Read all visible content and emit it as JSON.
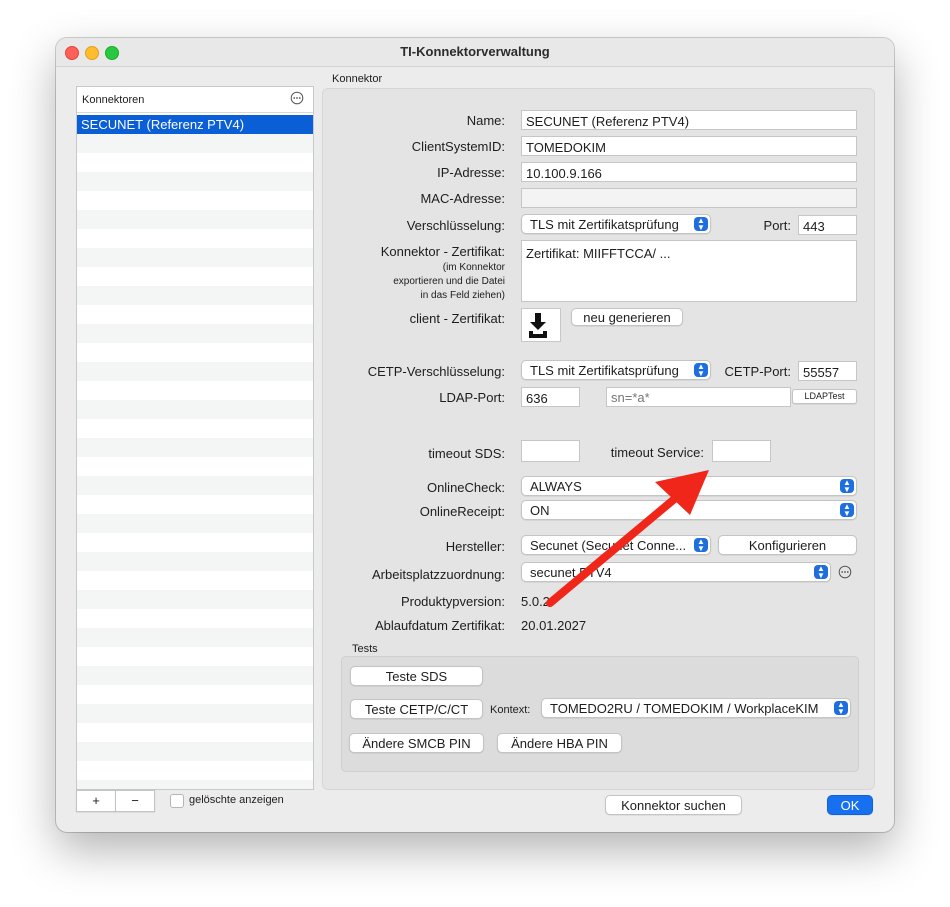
{
  "window": {
    "title": "TI-Konnektorverwaltung"
  },
  "sidebar": {
    "header": "Konnektoren",
    "header_icon": "ellipsis-circle-icon",
    "items": [
      {
        "label": "SECUNET (Referenz PTV4)",
        "selected": true
      }
    ],
    "add_label": "+",
    "remove_label": "−",
    "show_deleted_label": "gelöschte anzeigen"
  },
  "konnektor": {
    "section_label": "Konnektor",
    "name": {
      "label": "Name:",
      "value": "SECUNET (Referenz PTV4)"
    },
    "client_system_id": {
      "label": "ClientSystemID:",
      "value": "TOMEDOKIM"
    },
    "ip": {
      "label": "IP-Adresse:",
      "value": "10.100.9.166"
    },
    "mac": {
      "label": "MAC-Adresse:",
      "value": ""
    },
    "encryption": {
      "label": "Verschlüsselung:",
      "value": "TLS mit Zertifikatsprüfung"
    },
    "port": {
      "label": "Port:",
      "value": "443"
    },
    "cert": {
      "label": "Konnektor - Zertifikat:",
      "hint_line1": "(im Konnektor",
      "hint_line2": "exportieren und die Datei",
      "hint_line3": "in das Feld ziehen)",
      "value": "Zertifikat:  MIIFFTCCA/ ..."
    },
    "client_cert": {
      "label": "client - Zertifikat:",
      "regenerate_label": "neu generieren",
      "icon": "download-tray-icon"
    },
    "cetp_encryption": {
      "label": "CETP-Verschlüsselung:",
      "value": "TLS mit Zertifikatsprüfung"
    },
    "cetp_port": {
      "label": "CETP-Port:",
      "value": "55557"
    },
    "ldap_port": {
      "label": "LDAP-Port:",
      "value": "636"
    },
    "ldap_filter": {
      "placeholder": "sn=*a*"
    },
    "ldap_test_label": "LDAPTest",
    "timeout_sds": {
      "label": "timeout SDS:",
      "value": ""
    },
    "timeout_service": {
      "label": "timeout Service:",
      "value": ""
    },
    "online_check": {
      "label": "OnlineCheck:",
      "value": "ALWAYS"
    },
    "online_receipt": {
      "label": "OnlineReceipt:",
      "value": "ON"
    },
    "manufacturer": {
      "label": "Hersteller:",
      "value": "Secunet (Secunet Conne...",
      "configure_label": "Konfigurieren"
    },
    "workplace": {
      "label": "Arbeitsplatzzuordnung:",
      "value": "secunet PTV4"
    },
    "product_version": {
      "label": "Produktypversion:",
      "value": "5.0.2"
    },
    "cert_expiry": {
      "label": "Ablaufdatum  Zertifikat:",
      "value": "20.01.2027"
    }
  },
  "tests": {
    "section_label": "Tests",
    "test_sds_label": "Teste SDS",
    "test_cetp_label": "Teste CETP/C/CT",
    "context_label": "Kontext:",
    "context_value": "TOMEDO2RU / TOMEDOKIM / WorkplaceKIM",
    "change_smcb_label": "Ändere SMCB PIN",
    "change_hba_label": "Ändere HBA PIN"
  },
  "footer": {
    "search_label": "Konnektor suchen",
    "ok_label": "OK"
  },
  "colors": {
    "accent": "#0a5fd7",
    "annotation_arrow": "#f0261b"
  }
}
